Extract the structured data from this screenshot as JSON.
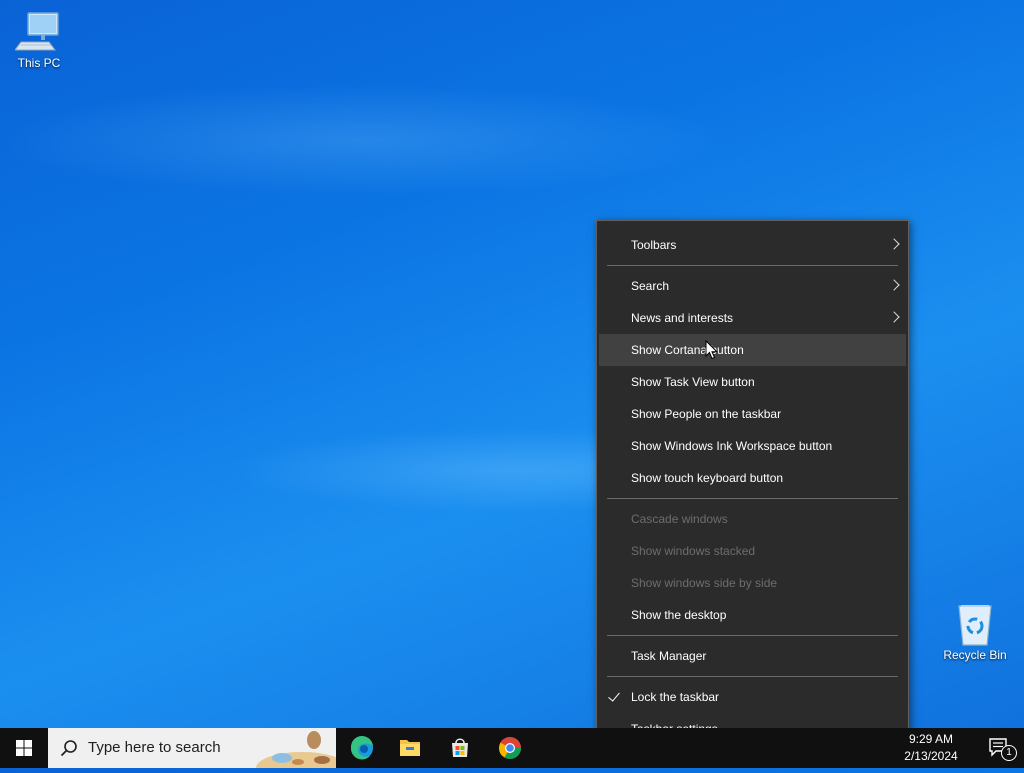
{
  "desktop": {
    "icons": [
      {
        "label": "This PC",
        "icon": "this-pc-icon"
      },
      {
        "label": "Recycle Bin",
        "icon": "recycle-bin-icon"
      }
    ]
  },
  "context_menu": {
    "items": [
      {
        "label": "Toolbars",
        "submenu": true
      },
      {
        "label": "Search",
        "submenu": true
      },
      {
        "label": "News and interests",
        "submenu": true
      },
      {
        "label": "Show Cortana button",
        "hover": true
      },
      {
        "label": "Show Task View button"
      },
      {
        "label": "Show People on the taskbar"
      },
      {
        "label": "Show Windows Ink Workspace button"
      },
      {
        "label": "Show touch keyboard button"
      },
      {
        "label": "Cascade windows",
        "disabled": true
      },
      {
        "label": "Show windows stacked",
        "disabled": true
      },
      {
        "label": "Show windows side by side",
        "disabled": true
      },
      {
        "label": "Show the desktop"
      },
      {
        "label": "Task Manager"
      },
      {
        "label": "Lock the taskbar",
        "checked": true
      },
      {
        "label": "Taskbar settings",
        "icon": "gear-icon"
      }
    ]
  },
  "taskbar": {
    "search_placeholder": "Type here to search",
    "pinned_apps": [
      "edge-icon",
      "file-explorer-icon",
      "microsoft-store-icon",
      "chrome-icon"
    ],
    "clock": {
      "time": "9:29 AM",
      "date": "2/13/2024"
    },
    "notification_count": "1"
  },
  "colors": {
    "menu_bg": "#2b2b2b",
    "menu_hover": "#414141",
    "taskbar_bg": "#101010",
    "accent": "#0078d7"
  }
}
